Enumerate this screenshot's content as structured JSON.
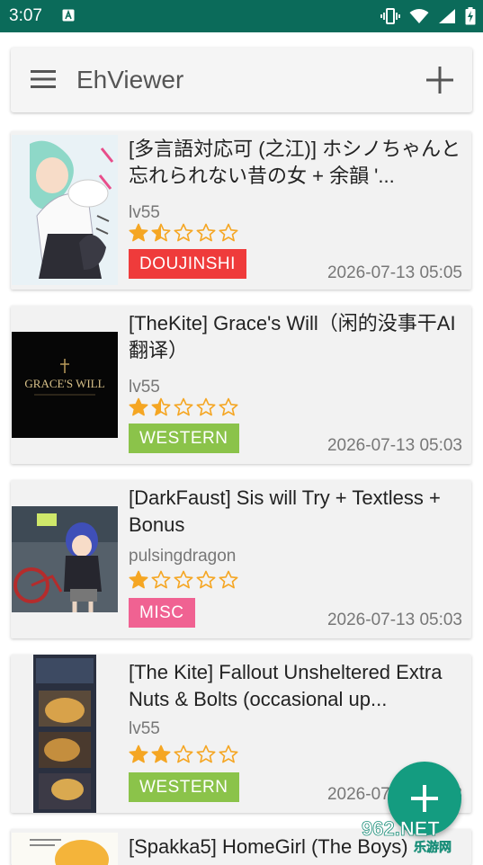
{
  "status_bar": {
    "time": "3:07"
  },
  "app_bar": {
    "title": "EhViewer"
  },
  "galleries": [
    {
      "title": "[多言語対応可 (之江)] ホシノちゃんと忘れられない昔の女 + 余韻 '...",
      "uploader": "lv55",
      "rating": 1.5,
      "category": "DOUJINSHI",
      "category_color": "#ef3b3b",
      "date": "2026-07-13 05:05"
    },
    {
      "title": "[TheKite] Grace's Will（闲的没事干AI翻译）",
      "uploader": "lv55",
      "rating": 1.5,
      "category": "WESTERN",
      "category_color": "#8bc34a",
      "date": "2026-07-13 05:03",
      "cover_text": "GRACE'S WILL"
    },
    {
      "title": "[DarkFaust] Sis will Try + Textless + Bonus",
      "uploader": "pulsingdragon",
      "rating": 1,
      "category": "MISC",
      "category_color": "#f06292",
      "date": "2026-07-13 05:03"
    },
    {
      "title": "[The Kite] Fallout Unsheltered Extra Nuts & Bolts (occasional up...",
      "uploader": "lv55",
      "rating": 2,
      "category": "WESTERN",
      "category_color": "#8bc34a",
      "date": "2026-07-13 05:03"
    },
    {
      "title": "[Spakka5] HomeGirl (The Boys)"
    }
  ],
  "watermark": {
    "text": "962.NET",
    "subtext": "乐游网"
  },
  "colors": {
    "status_bar": "#0b6b5a",
    "fab": "#149c80",
    "star": "#f5a623"
  }
}
